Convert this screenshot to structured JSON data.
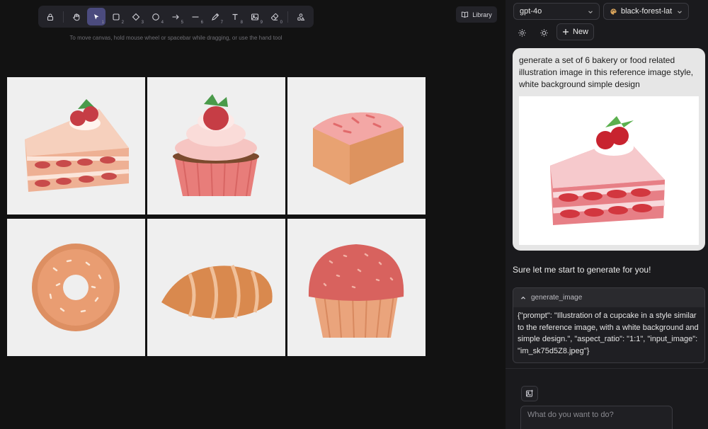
{
  "toolbar": {
    "tools": [
      {
        "name": "lock",
        "num": ""
      },
      {
        "name": "hand",
        "num": ""
      },
      {
        "name": "select",
        "num": "1",
        "active": true
      },
      {
        "name": "rectangle",
        "num": "2"
      },
      {
        "name": "diamond",
        "num": "3"
      },
      {
        "name": "ellipse",
        "num": "4"
      },
      {
        "name": "arrow",
        "num": "5"
      },
      {
        "name": "line",
        "num": "6"
      },
      {
        "name": "draw",
        "num": "7"
      },
      {
        "name": "text",
        "num": "8"
      },
      {
        "name": "image",
        "num": "9"
      },
      {
        "name": "eraser",
        "num": "0"
      },
      {
        "name": "more-shapes",
        "num": ""
      }
    ],
    "accent": "#4b4b7e"
  },
  "canvas": {
    "hint": "To move canvas, hold mouse wheel or spacebar while dragging, or use the hand tool",
    "library_label": "Library",
    "images": [
      "strawberry-cake-slice",
      "strawberry-cupcake",
      "pound-cake",
      "donut",
      "croissant",
      "muffin"
    ]
  },
  "panel": {
    "model": "gpt-4o",
    "style": "black-forest-lat",
    "new_label": "New",
    "user_message": "generate a set of 6 bakery or food related illustration image in this reference image style, white background simple design",
    "assistant_reply": "Sure let me start to generate for you!",
    "tool_call": {
      "name": "generate_image",
      "arguments": "{\"prompt\": \"Illustration of a cupcake in a style similar to the reference image, with a white background and simple design.\", \"aspect_ratio\": \"1:1\", \"input_image\": \"im_sk75d5Z8.jpeg\"}"
    },
    "input_placeholder": "What do you want to do?"
  }
}
